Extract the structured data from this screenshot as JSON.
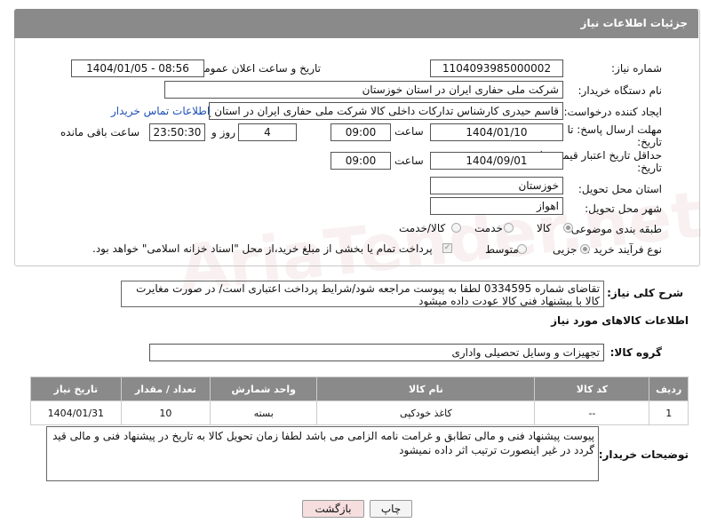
{
  "panel": {
    "title": "جزئیات اطلاعات نیاز"
  },
  "fields": {
    "need_number": {
      "label": "شماره نیاز:",
      "value": "1104093985000002"
    },
    "announce": {
      "label": "تاریخ و ساعت اعلان عمومی:",
      "value": "1404/01/05 - 08:56"
    },
    "buyer_org": {
      "label": "نام دستگاه خریدار:",
      "value": "شرکت ملی حفاری ایران در استان خوزستان"
    },
    "creator": {
      "label": "ایجاد کننده درخواست:",
      "value": "قاسم حیدری کارشناس تدارکات داخلی کالا شرکت ملی حفاری ایران در استان خ",
      "link": "اطلاعات تماس خریدار"
    },
    "deadline": {
      "label_line1": "مهلت ارسال پاسخ: تا",
      "label_line2": "تاریخ:",
      "date": "1404/01/10",
      "time_label": "ساعت",
      "time": "09:00",
      "days": "4",
      "days_label": "روز و",
      "remaining": "23:50:30",
      "remaining_label": "ساعت باقی مانده"
    },
    "validity": {
      "label_line1": "حداقل تاریخ اعتبار قیمت: تا",
      "label_line2": "تاریخ:",
      "date": "1404/09/01",
      "time_label": "ساعت",
      "time": "09:00"
    },
    "province": {
      "label": "استان محل تحویل:",
      "value": "خوزستان"
    },
    "city": {
      "label": "شهر محل تحویل:",
      "value": "اهواز"
    },
    "category": {
      "label": "طبقه بندی موضوعی:",
      "options": [
        "کالا",
        "خدمت",
        "کالا/خدمت"
      ],
      "selected": "کالا"
    },
    "purchase_type": {
      "label": "نوع فرآیند خرید :",
      "options": [
        "جزیی",
        "متوسط"
      ],
      "selected": "جزیی",
      "note": "پرداخت تمام یا بخشی از مبلغ خرید،از محل \"اسناد خزانه اسلامی\" خواهد بود."
    }
  },
  "summary": {
    "label": "شرح کلی نیاز:",
    "text": "تقاضای شماره 0334595 لطفا به پیوست مراجعه شود/شرایط پرداخت اعتباری است/ در صورت مغایرت کالا با پیشنهاد فنی کالا عودت داده میشود"
  },
  "goods_section": {
    "title": "اطلاعات کالاهای مورد نیاز"
  },
  "goods_group": {
    "label": "گروه کالا:",
    "value": "تجهیزات و وسایل تحصیلی واداری"
  },
  "table": {
    "headers": [
      "ردیف",
      "کد کالا",
      "نام کالا",
      "واحد شمارش",
      "تعداد / مقدار",
      "تاریخ نیاز"
    ],
    "rows": [
      [
        "1",
        "--",
        "کاغذ خودکپی",
        "بسته",
        "10",
        "1404/01/31"
      ]
    ]
  },
  "buyer_notes": {
    "label": "توضیحات خریدار:",
    "text": "پیوست پیشنهاد فنی و مالی تطابق و غرامت نامه الزامی می باشد لطفا زمان تحویل کالا به تاریخ در پیشنهاد فنی و مالی قید گردد در غیر اینصورت ترتیب اثر داده نمیشود"
  },
  "buttons": {
    "print": "چاپ",
    "back": "بازگشت"
  },
  "watermark": "AriaTender.net",
  "colors": {
    "header": "#8a8a8a",
    "link": "#1a4fb5",
    "back_button": "#f6dede"
  }
}
